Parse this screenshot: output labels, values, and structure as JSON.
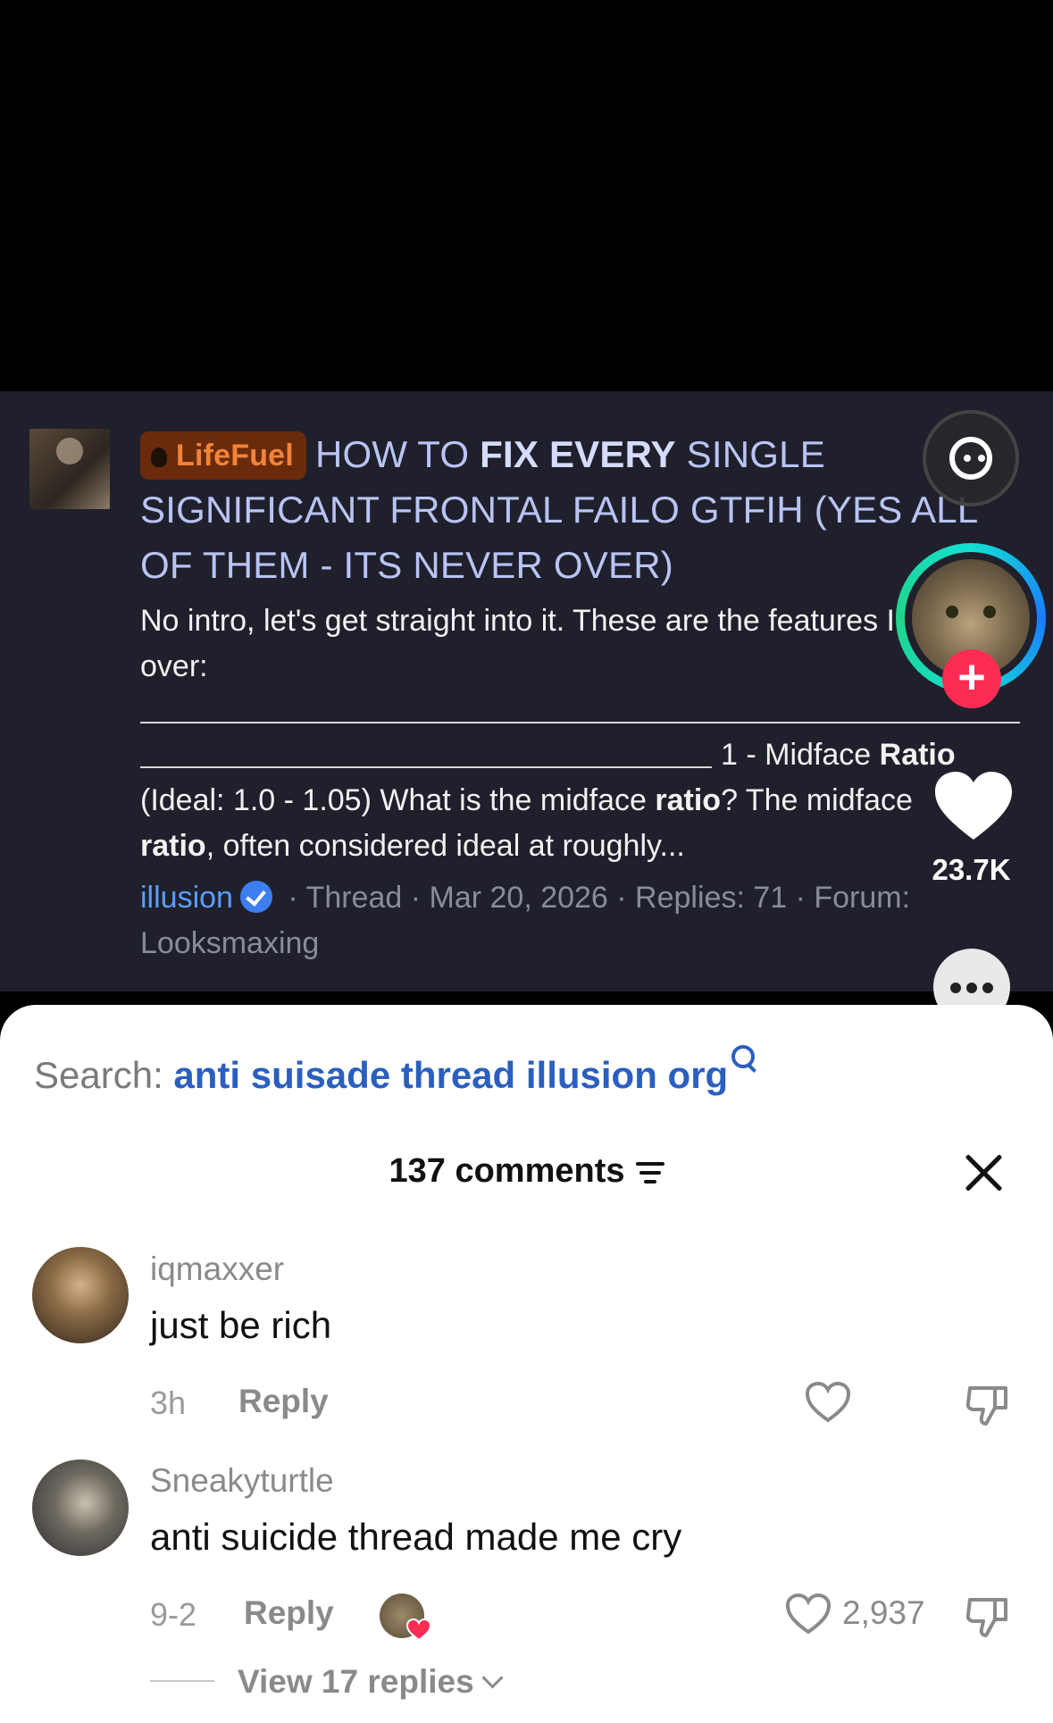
{
  "post": {
    "prefix": "LifeFuel",
    "title_parts": [
      "HOW TO ",
      "FIX EVERY",
      " SINGLE SIGNIFICANT FRONTAL FAILO GTFIH (YES ALL OF THEM - ITS NEVER OVER)"
    ],
    "excerpt": "No intro, let's get straight into it. These are the features I will go over:",
    "midface_heading": "1 - Midface",
    "midface_bold": "Ratio",
    "midface_line2a": "(Ideal: 1.0 - 1.05) What is the midface ",
    "midface_line2b": "ratio",
    "midface_line2c": "? The midface",
    "midface_line3a": "ratio",
    "midface_line3b": ", often considered ideal at roughly...",
    "author": "illusion",
    "meta": " · Thread · Mar 20, 2026 · Replies: 71 · Forum: Looksmaxing"
  },
  "sidebar": {
    "like_count": "23.7K",
    "follow_symbol": "+"
  },
  "search": {
    "label": "Search:",
    "query": "anti suisade thread illusion org"
  },
  "comments_header": {
    "count_label": "137 comments"
  },
  "comments": [
    {
      "user": "iqmaxxer",
      "text": "just be rich",
      "time": "3h",
      "reply": "Reply",
      "likes": ""
    },
    {
      "user": "Sneakyturtle",
      "text": "anti suicide thread made me cry",
      "time": "9-2",
      "reply": "Reply",
      "likes": "2,937",
      "view_replies": "View 17 replies"
    }
  ],
  "colors": {
    "video_bg": "#1f202b",
    "accent_red": "#fe2c55",
    "search_link": "#2b5fbf",
    "author_link": "#5b9dff"
  }
}
